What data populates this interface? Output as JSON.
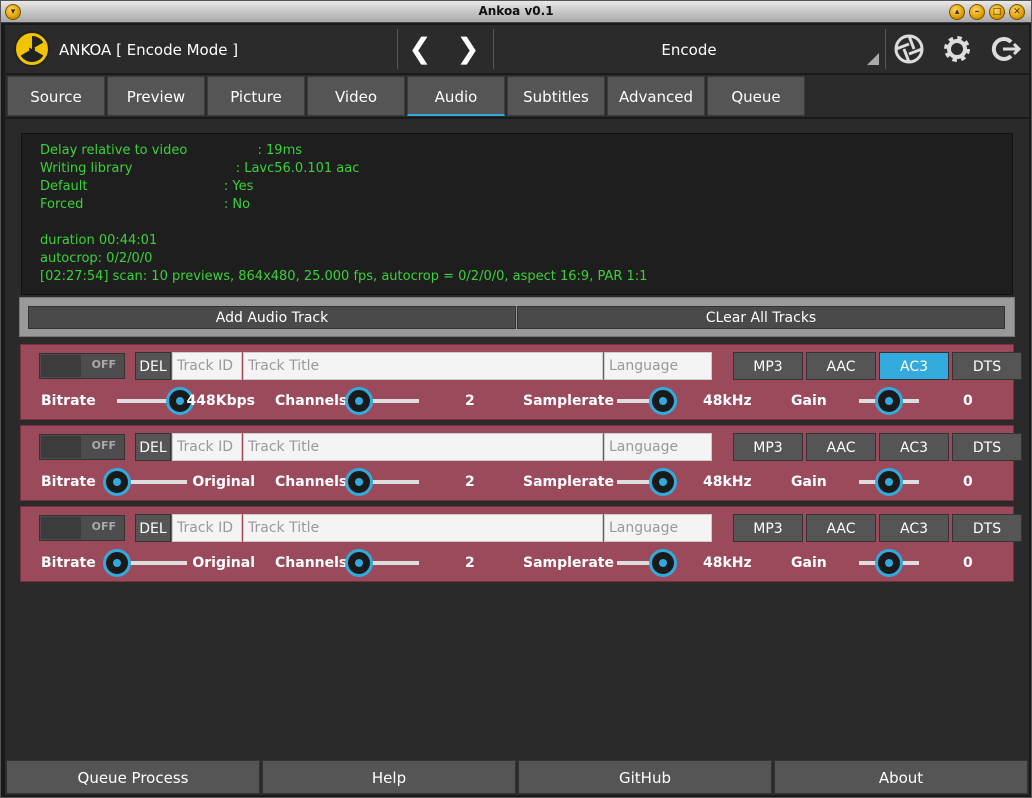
{
  "window": {
    "title": "Ankoa v0.1"
  },
  "toolbar": {
    "app_title": "ANKOA  [ Encode  Mode ]",
    "back_label": "❮",
    "forward_label": "❯",
    "mode_value": "Encode"
  },
  "tabs": [
    {
      "label": "Source"
    },
    {
      "label": "Preview"
    },
    {
      "label": "Picture"
    },
    {
      "label": "Video"
    },
    {
      "label": "Audio",
      "active": true
    },
    {
      "label": "Subtitles"
    },
    {
      "label": "Advanced"
    },
    {
      "label": "Queue"
    }
  ],
  "log": [
    "Delay relative to video                 : 19ms",
    "Writing library                         : Lavc56.0.101 aac",
    "Default                                 : Yes",
    "Forced                                  : No",
    "",
    "duration 00:44:01",
    "autocrop: 0/2/0/0",
    "[02:27:54] scan: 10 previews, 864x480, 25.000 fps, autocrop = 0/2/0/0, aspect 16:9, PAR 1:1"
  ],
  "track_actions": {
    "add_label": "Add Audio Track",
    "clear_label": "CLear All Tracks"
  },
  "labels": {
    "toggle_off": "OFF",
    "del": "DEL",
    "track_id_placeholder": "Track ID",
    "track_title_placeholder": "Track Title",
    "language_placeholder": "Language",
    "bitrate": "Bitrate",
    "channels": "Channels",
    "samplerate": "Samplerate",
    "gain": "Gain",
    "codecs": [
      "MP3",
      "AAC",
      "AC3",
      "DTS"
    ]
  },
  "tracks": [
    {
      "bitrate": "448Kbps",
      "bitrate_level": 0.9,
      "channels": "2",
      "channels_level": 0.0,
      "samplerate": "48kHz",
      "samplerate_level": 1.0,
      "gain": "0",
      "gain_level": 0.5,
      "codec": "AC3"
    },
    {
      "bitrate": "Original",
      "bitrate_level": 0.0,
      "channels": "2",
      "channels_level": 0.0,
      "samplerate": "48kHz",
      "samplerate_level": 1.0,
      "gain": "0",
      "gain_level": 0.5,
      "codec": ""
    },
    {
      "bitrate": "Original",
      "bitrate_level": 0.0,
      "channels": "2",
      "channels_level": 0.0,
      "samplerate": "48kHz",
      "samplerate_level": 1.0,
      "gain": "0",
      "gain_level": 0.5,
      "codec": ""
    }
  ],
  "bottom": {
    "queue_process": "Queue Process",
    "help": "Help",
    "github": "GitHub",
    "about": "About"
  },
  "colors": {
    "accent": "#33aadd",
    "track_bg": "#9b4a5b",
    "log_text": "#3bd13b"
  }
}
